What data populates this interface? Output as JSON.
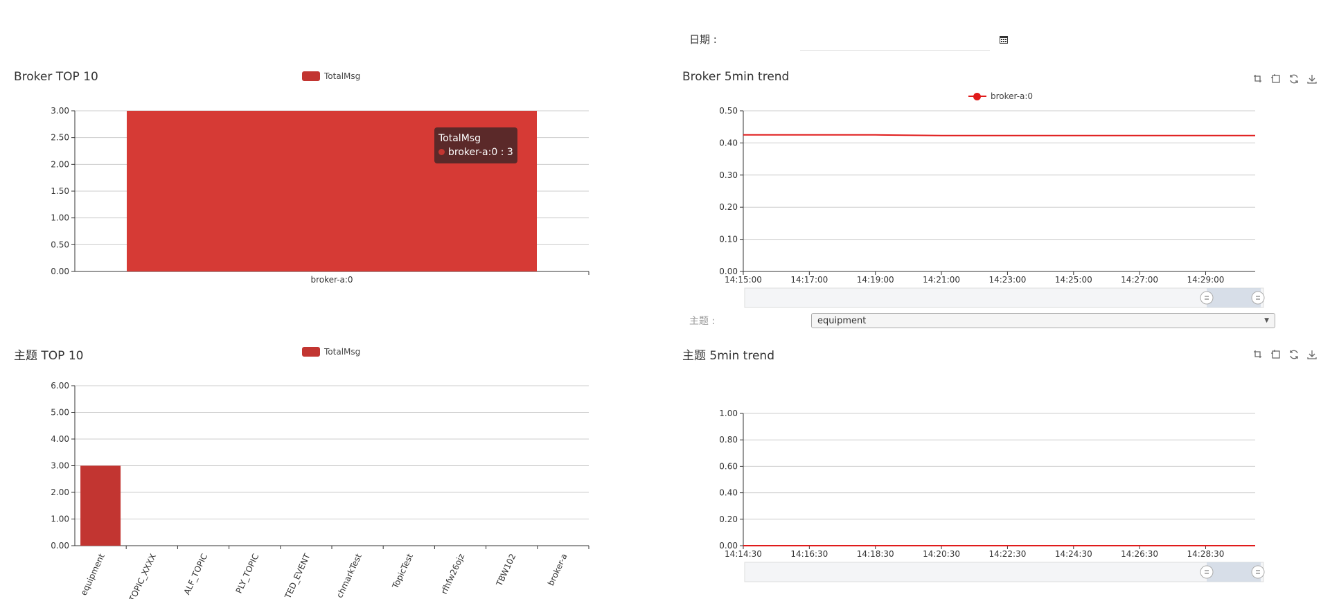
{
  "date_filter": {
    "label": "日期 :",
    "value": ""
  },
  "topic_filter": {
    "label": "主题 :",
    "selected": "equipment"
  },
  "colors": {
    "bar": "#c23531",
    "bar_highlight": "#d63a35",
    "line": "#e01b1b"
  },
  "toolbox_icons": [
    "zoom-icon",
    "zoom-reset-icon",
    "restore-icon",
    "download-icon"
  ],
  "chart_data": [
    {
      "id": "broker_top10",
      "type": "bar",
      "title": "Broker TOP 10",
      "legend": [
        "TotalMsg"
      ],
      "categories": [
        "broker-a:0"
      ],
      "series": [
        {
          "name": "TotalMsg",
          "values": [
            3
          ]
        }
      ],
      "ylim": [
        0,
        3
      ],
      "yticks": [
        "0.00",
        "0.50",
        "1.00",
        "1.50",
        "2.00",
        "2.50",
        "3.00"
      ],
      "grid": true,
      "tooltip": {
        "title": "TotalMsg",
        "line": "broker-a:0 : 3"
      }
    },
    {
      "id": "broker_trend",
      "type": "line",
      "title": "Broker 5min trend",
      "legend": [
        "broker-a:0"
      ],
      "x": [
        "14:15:00",
        "14:17:00",
        "14:19:00",
        "14:21:00",
        "14:23:00",
        "14:25:00",
        "14:27:00",
        "14:29:00",
        "14:30:00"
      ],
      "xticks": [
        "14:15:00",
        "14:17:00",
        "14:19:00",
        "14:21:00",
        "14:23:00",
        "14:25:00",
        "14:27:00",
        "14:29:00"
      ],
      "series": [
        {
          "name": "broker-a:0",
          "values": [
            0.425,
            0.425,
            0.425,
            0.423,
            0.423,
            0.423,
            0.423,
            0.423,
            0.423
          ]
        }
      ],
      "ylim": [
        0,
        0.5
      ],
      "yticks": [
        "0.00",
        "0.10",
        "0.20",
        "0.30",
        "0.40",
        "0.50"
      ],
      "grid": true
    },
    {
      "id": "topic_top10",
      "type": "bar",
      "title": "主题 TOP 10",
      "legend": [
        "TotalMsg"
      ],
      "categories": [
        "equipment",
        "TOPIC_XXXX",
        "ALF_TOPIC",
        "PLY_TOPIC",
        "TED_EVENT",
        "chmarkTest",
        "TopicTest",
        "rfhfw26ojz",
        "TBW102",
        "broker-a"
      ],
      "series": [
        {
          "name": "TotalMsg",
          "values": [
            3,
            0,
            0,
            0,
            0,
            0,
            0,
            0,
            0,
            0
          ]
        }
      ],
      "ylim": [
        0,
        6
      ],
      "yticks": [
        "0.00",
        "1.00",
        "2.00",
        "3.00",
        "4.00",
        "5.00",
        "6.00"
      ],
      "grid": true
    },
    {
      "id": "topic_trend",
      "type": "line",
      "title": "主题 5min trend",
      "legend": [],
      "x": [
        "14:14:30",
        "14:16:30",
        "14:18:30",
        "14:20:30",
        "14:22:30",
        "14:24:30",
        "14:26:30",
        "14:28:30",
        "14:29:30"
      ],
      "xticks": [
        "14:14:30",
        "14:16:30",
        "14:18:30",
        "14:20:30",
        "14:22:30",
        "14:24:30",
        "14:26:30",
        "14:28:30"
      ],
      "series": [
        {
          "name": "",
          "values": [
            0,
            0,
            0,
            0,
            0,
            0,
            0,
            0,
            0
          ]
        }
      ],
      "ylim": [
        0,
        1
      ],
      "yticks": [
        "0.00",
        "0.20",
        "0.40",
        "0.60",
        "0.80",
        "1.00"
      ],
      "grid": true
    }
  ]
}
